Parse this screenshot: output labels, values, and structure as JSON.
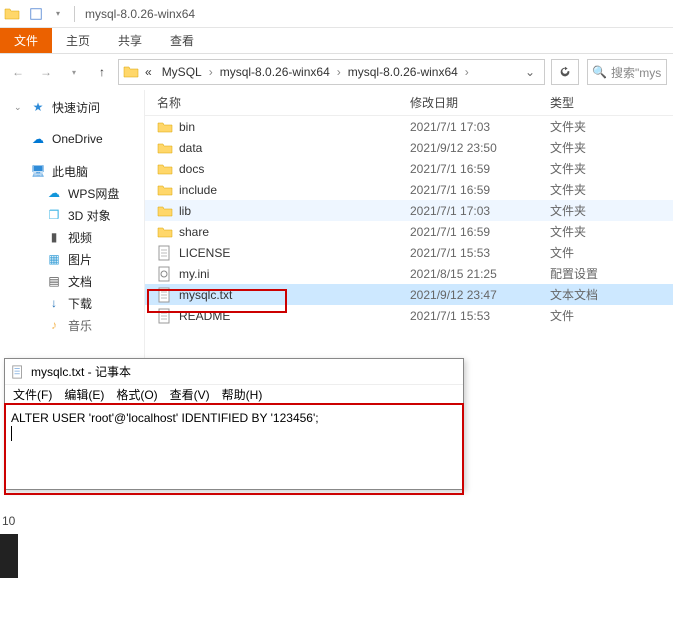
{
  "window": {
    "title": "mysql-8.0.26-winx64"
  },
  "ribbon": {
    "tabs": [
      {
        "label": "文件",
        "active": true
      },
      {
        "label": "主页",
        "active": false
      },
      {
        "label": "共享",
        "active": false
      },
      {
        "label": "查看",
        "active": false
      }
    ]
  },
  "breadcrumb": {
    "prefix": "«",
    "parts": [
      "MySQL",
      "mysql-8.0.26-winx64",
      "mysql-8.0.26-winx64"
    ]
  },
  "search": {
    "placeholder": "搜索\"mys"
  },
  "sidebar": {
    "items": [
      {
        "label": "快速访问",
        "icon": "star",
        "color": "#2e8bd8",
        "arrow": true
      },
      {
        "label": "OneDrive",
        "icon": "cloud",
        "color": "#0078d4",
        "spacer_before": true
      },
      {
        "label": "此电脑",
        "icon": "pc",
        "color": "#2e8bd8",
        "spacer_before": true
      },
      {
        "label": "WPS网盘",
        "icon": "cloud2",
        "color": "#1296db",
        "indent": true
      },
      {
        "label": "3D 对象",
        "icon": "cube",
        "color": "#41b6e6",
        "indent": true
      },
      {
        "label": "视频",
        "icon": "video",
        "color": "#555",
        "indent": true
      },
      {
        "label": "图片",
        "icon": "picture",
        "color": "#3aa0d8",
        "indent": true
      },
      {
        "label": "文档",
        "icon": "doc",
        "color": "#555",
        "indent": true
      },
      {
        "label": "下载",
        "icon": "download",
        "color": "#1f6fb5",
        "indent": true
      },
      {
        "label": "音乐",
        "icon": "music",
        "color": "#f0a020",
        "indent": true,
        "cut": true
      }
    ]
  },
  "columns": {
    "name": "名称",
    "date": "修改日期",
    "type": "类型"
  },
  "files": [
    {
      "name": "bin",
      "date": "2021/7/1 17:03",
      "type": "文件夹",
      "icon": "folder"
    },
    {
      "name": "data",
      "date": "2021/9/12 23:50",
      "type": "文件夹",
      "icon": "folder"
    },
    {
      "name": "docs",
      "date": "2021/7/1 16:59",
      "type": "文件夹",
      "icon": "folder"
    },
    {
      "name": "include",
      "date": "2021/7/1 16:59",
      "type": "文件夹",
      "icon": "folder"
    },
    {
      "name": "lib",
      "date": "2021/7/1 17:03",
      "type": "文件夹",
      "icon": "folder",
      "hover": true
    },
    {
      "name": "share",
      "date": "2021/7/1 16:59",
      "type": "文件夹",
      "icon": "folder"
    },
    {
      "name": "LICENSE",
      "date": "2021/7/1 15:53",
      "type": "文件",
      "icon": "file"
    },
    {
      "name": "my.ini",
      "date": "2021/8/15 21:25",
      "type": "配置设置",
      "icon": "ini"
    },
    {
      "name": "mysqlc.txt",
      "date": "2021/9/12 23:47",
      "type": "文本文档",
      "icon": "txt",
      "selected": true
    },
    {
      "name": "README",
      "date": "2021/7/1 15:53",
      "type": "文件",
      "icon": "file"
    }
  ],
  "notepad": {
    "title": "mysqlc.txt - 记事本",
    "menu": [
      "文件(F)",
      "编辑(E)",
      "格式(O)",
      "查看(V)",
      "帮助(H)"
    ],
    "content": "ALTER USER 'root'@'localhost' IDENTIFIED BY '123456';"
  },
  "footer": {
    "count": "10"
  }
}
